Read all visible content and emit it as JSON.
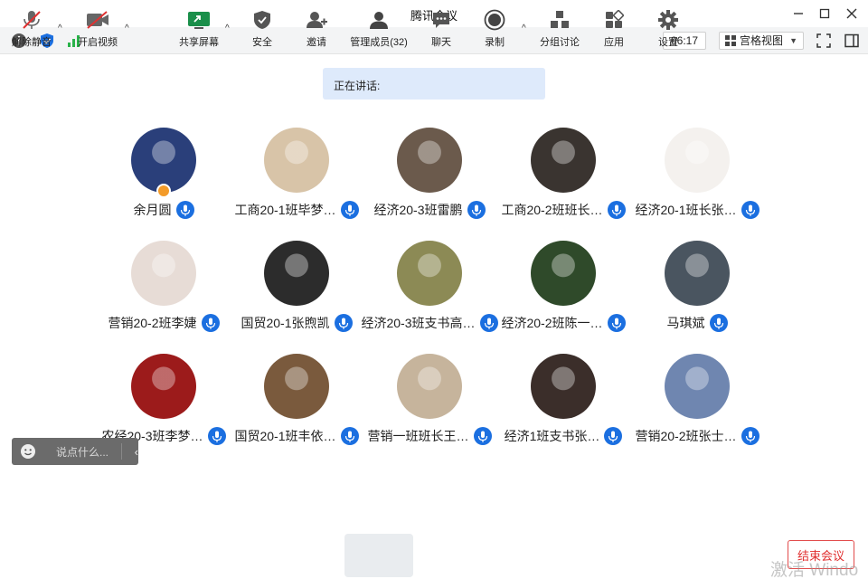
{
  "window": {
    "title": "腾讯会议"
  },
  "toolbar": {
    "time": "06:17",
    "view_label": "宫格视图"
  },
  "speaking": {
    "label": "正在讲话:"
  },
  "participants": [
    {
      "name": "余月圆",
      "host": true,
      "color": "#2a3f7a"
    },
    {
      "name": "工商20-1班毕梦…",
      "color": "#d8c4a8"
    },
    {
      "name": "经济20-3班雷鹏",
      "color": "#6b5a4c"
    },
    {
      "name": "工商20-2班班长…",
      "color": "#3a3430"
    },
    {
      "name": "经济20-1班长张…",
      "color": "#f4f1ee"
    },
    {
      "name": "营销20-2班李婕",
      "color": "#e7dcd6"
    },
    {
      "name": "国贸20-1张煦凯",
      "color": "#2c2c2c"
    },
    {
      "name": "经济20-3班支书高…",
      "color": "#8c8a55"
    },
    {
      "name": "经济20-2班陈一…",
      "color": "#2f4a2a"
    },
    {
      "name": "马琪斌",
      "color": "#4a5560"
    },
    {
      "name": "农经20-3班李梦…",
      "color": "#9c1b1b"
    },
    {
      "name": "国贸20-1班丰依…",
      "color": "#7a5a3d"
    },
    {
      "name": "营销一班班长王…",
      "color": "#c6b49c"
    },
    {
      "name": "经济1班支书张…",
      "color": "#3b2e2a"
    },
    {
      "name": "营销20-2班张士…",
      "color": "#6f86b0"
    }
  ],
  "chat": {
    "placeholder": "说点什么..."
  },
  "bottom": {
    "unmute": "解除静音",
    "video": "开启视频",
    "share": "共享屏幕",
    "security": "安全",
    "invite": "邀请",
    "members": "管理成员(32)",
    "chat": "聊天",
    "record": "录制",
    "breakout": "分组讨论",
    "apps": "应用",
    "settings": "设置",
    "end": "结束会议"
  },
  "watermark": "激活 Windo"
}
